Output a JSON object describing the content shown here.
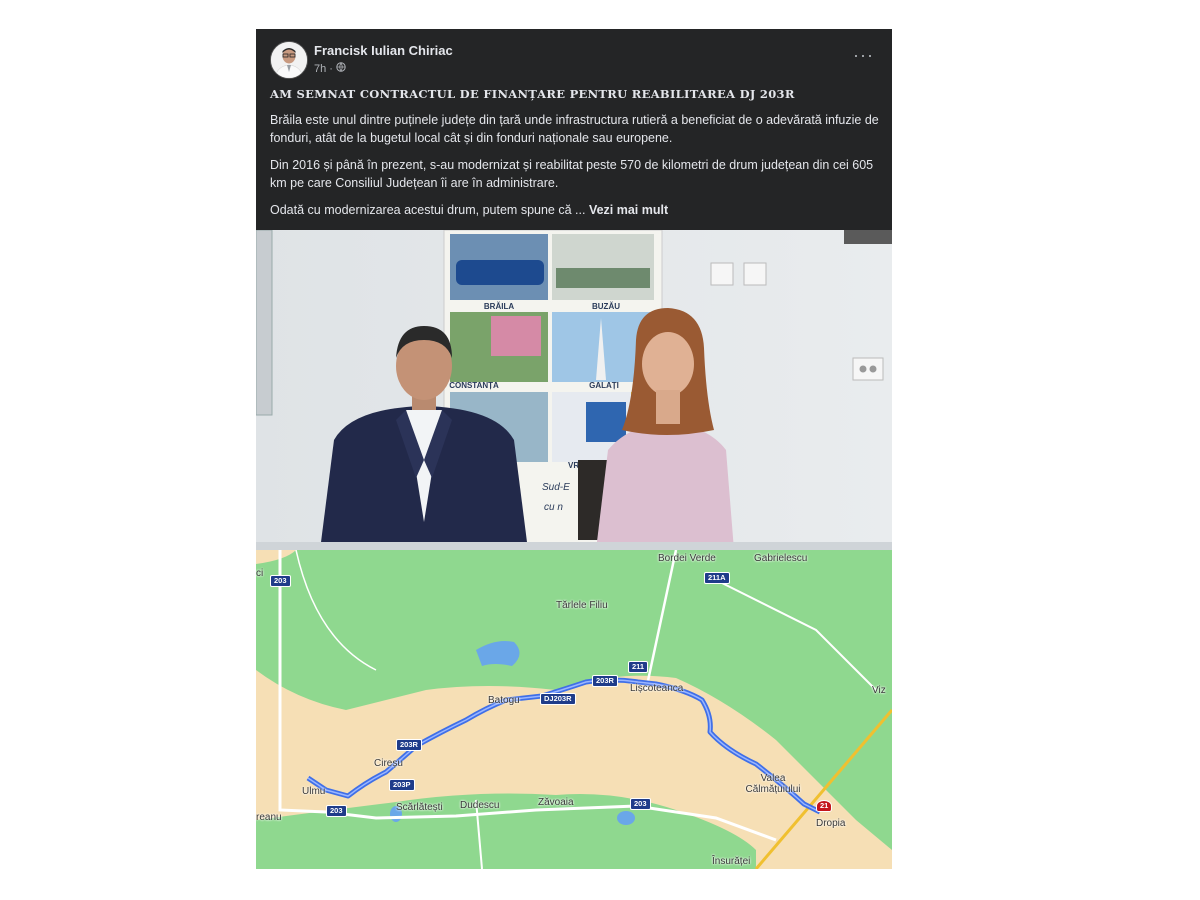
{
  "post": {
    "author": "Francisk Iulian Chiriac",
    "time": "7h ·",
    "more_label": "···",
    "headline": "AM SEMNAT CONTRACTUL DE FINANȚARE PENTRU REABILITAREA DJ 203R",
    "paragraphs": [
      "Brăila este unul dintre puținele județe din țară unde infrastructura rutieră a beneficiat de o adevărată infuzie de fonduri, atât de la bugetul local cât și din fonduri naționale sau europene.",
      "Din 2016 și până în prezent, s-au modernizat și reabilitat peste 570 de kilometri de drum județean din cei 605 km pe care Consiliul Județean îi are în administrare.",
      "Odată cu modernizarea acestui drum, putem spune că ..."
    ],
    "see_more": "Vezi mai mult",
    "privacy_icon": "globe-icon"
  },
  "poster": {
    "captions": [
      "BRĂILA",
      "BUZĂU",
      "CONSTANȚA",
      "GALAȚI",
      "VRANCEA"
    ],
    "text_fragments": [
      "Sud-E",
      "cu n"
    ]
  },
  "map": {
    "places": [
      "Bordei Verde",
      "Gabrielescu",
      "Tărlele Filiu",
      "Batogu",
      "Lișcoteanca",
      "Cireșu",
      "Ulmu",
      "Scărlătești",
      "Dudescu",
      "Zăvoaia",
      "Valea Călmățuiului",
      "Dropia",
      "Viz",
      "reanu",
      "ci",
      "Însurăței"
    ],
    "road_labels": [
      "203",
      "211A",
      "211",
      "203R",
      "DJ203R",
      "203R",
      "203P",
      "203",
      "203",
      "21"
    ],
    "colors": {
      "land_green": "#8fd88f",
      "farmland": "#f6dfb5",
      "route": "#3f6fe8",
      "water": "#6aa7e8"
    }
  }
}
